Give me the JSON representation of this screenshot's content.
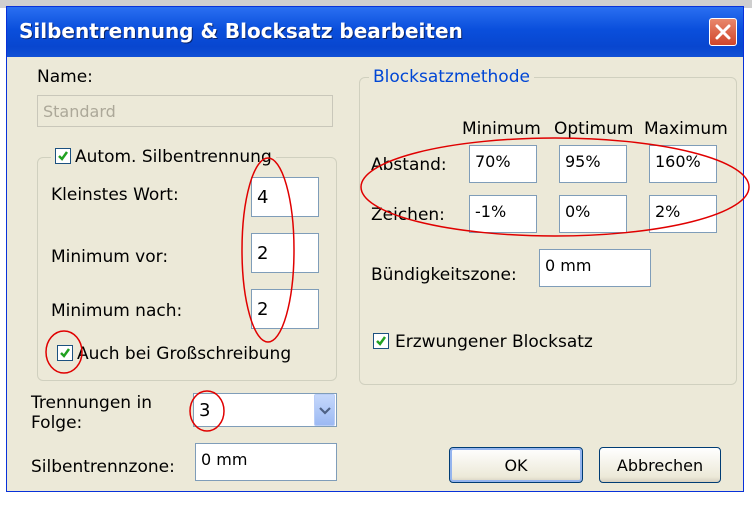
{
  "dialog": {
    "title": "Silbentrennung & Blocksatz bearbeiten"
  },
  "left": {
    "name_label": "Name:",
    "name_value": "Standard",
    "auto_hyphenation_label": "Autom. Silbentrennung",
    "auto_hyphenation_checked": true,
    "shortest_word_label": "Kleinstes Wort:",
    "shortest_word_value": "4",
    "min_before_label": "Minimum vor:",
    "min_before_value": "2",
    "min_after_label": "Minimum nach:",
    "min_after_value": "2",
    "capitalized_label": "Auch bei Großschreibung",
    "capitalized_checked": true,
    "consecutive_label_line1": "Trennungen in",
    "consecutive_label_line2": "Folge:",
    "consecutive_value": "3",
    "zone_label": "Silbentrennzone:",
    "zone_value": "0 mm"
  },
  "justification": {
    "legend": "Blocksatzmethode",
    "col_min": "Minimum",
    "col_opt": "Optimum",
    "col_max": "Maximum",
    "spacing_label": "Abstand:",
    "spacing_min": "70%",
    "spacing_opt": "95%",
    "spacing_max": "160%",
    "chars_label": "Zeichen:",
    "chars_min": "-1%",
    "chars_opt": "0%",
    "chars_max": "2%",
    "flush_zone_label": "Bündigkeitszone:",
    "flush_zone_value": "0 mm",
    "forced_label": "Erzwungener Blocksatz",
    "forced_checked": true
  },
  "buttons": {
    "ok": "OK",
    "cancel": "Abbrechen"
  },
  "colors": {
    "titlebar": "#0a4fdc",
    "legend_text": "#0046d5",
    "annotation": "#e00000",
    "checkmark": "#21a121"
  }
}
